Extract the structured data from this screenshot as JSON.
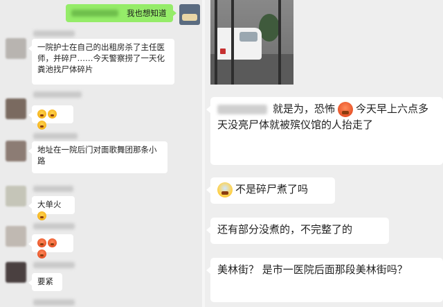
{
  "left_chat": {
    "self_message": {
      "text": "我也想知道"
    },
    "messages": [
      {
        "text": "一院护士在自己的出租房杀了主任医师，并碎尸……今天警察捞了一天化粪池找尸体碎片"
      },
      {
        "emojis": [
          "scream-emoji",
          "scream-emoji",
          "scream-emoji"
        ]
      },
      {
        "text": "地址在一院后门对面歌舞团那条小路"
      },
      {
        "text": "大单火"
      },
      {
        "emojis": [
          "scream-emoji",
          "scream-emoji",
          "scream-emoji"
        ]
      },
      {
        "text": "要紧"
      }
    ]
  },
  "right_chat": {
    "messages": [
      {
        "text": "就是为，恐怖",
        "text2": "今天早上六点多天没亮尸体就被殡仪馆的人抬走了"
      },
      {
        "text": "不是碎尸煮了吗"
      },
      {
        "text": "还有部分没煮的，不完整了的"
      },
      {
        "text": "美林街？ 是市一医院后面那段美林街吗？"
      }
    ]
  }
}
